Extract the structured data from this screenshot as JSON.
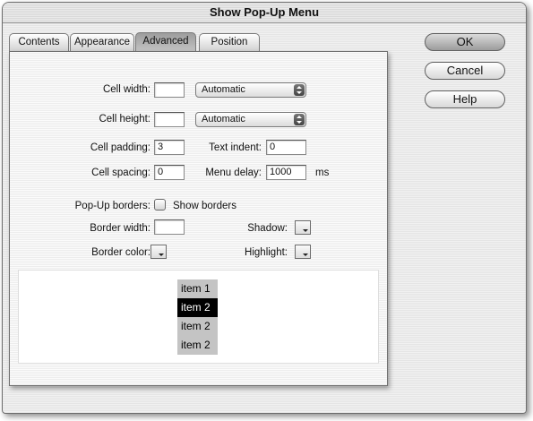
{
  "window": {
    "title": "Show Pop-Up Menu"
  },
  "tabs": [
    {
      "label": "Contents"
    },
    {
      "label": "Appearance"
    },
    {
      "label": "Advanced",
      "active": true
    },
    {
      "label": "Position"
    }
  ],
  "buttons": {
    "ok": "OK",
    "cancel": "Cancel",
    "help": "Help"
  },
  "advanced": {
    "cell_width": {
      "label": "Cell width:",
      "value": "",
      "mode": "Automatic"
    },
    "cell_height": {
      "label": "Cell height:",
      "value": "",
      "mode": "Automatic"
    },
    "cell_padding": {
      "label": "Cell padding:",
      "value": "3"
    },
    "text_indent": {
      "label": "Text indent:",
      "value": "0"
    },
    "cell_spacing": {
      "label": "Cell spacing:",
      "value": "0"
    },
    "menu_delay": {
      "label": "Menu delay:",
      "value": "1000",
      "unit": "ms"
    },
    "popup_borders": {
      "label": "Pop-Up borders:",
      "checkbox_label": "Show borders",
      "checked": false
    },
    "border_width": {
      "label": "Border width:",
      "value": ""
    },
    "shadow": {
      "label": "Shadow:"
    },
    "border_color": {
      "label": "Border color:"
    },
    "highlight": {
      "label": "Highlight:"
    }
  },
  "preview": {
    "items": [
      {
        "label": "item 1",
        "selected": false
      },
      {
        "label": "item 2",
        "selected": true
      },
      {
        "label": "item 2",
        "selected": false
      },
      {
        "label": "item 2",
        "selected": false
      }
    ]
  },
  "colors": {
    "menu_item_bg": "#c4c4c4",
    "menu_item_selected_bg": "#000000",
    "menu_item_selected_text": "#ffffff"
  }
}
